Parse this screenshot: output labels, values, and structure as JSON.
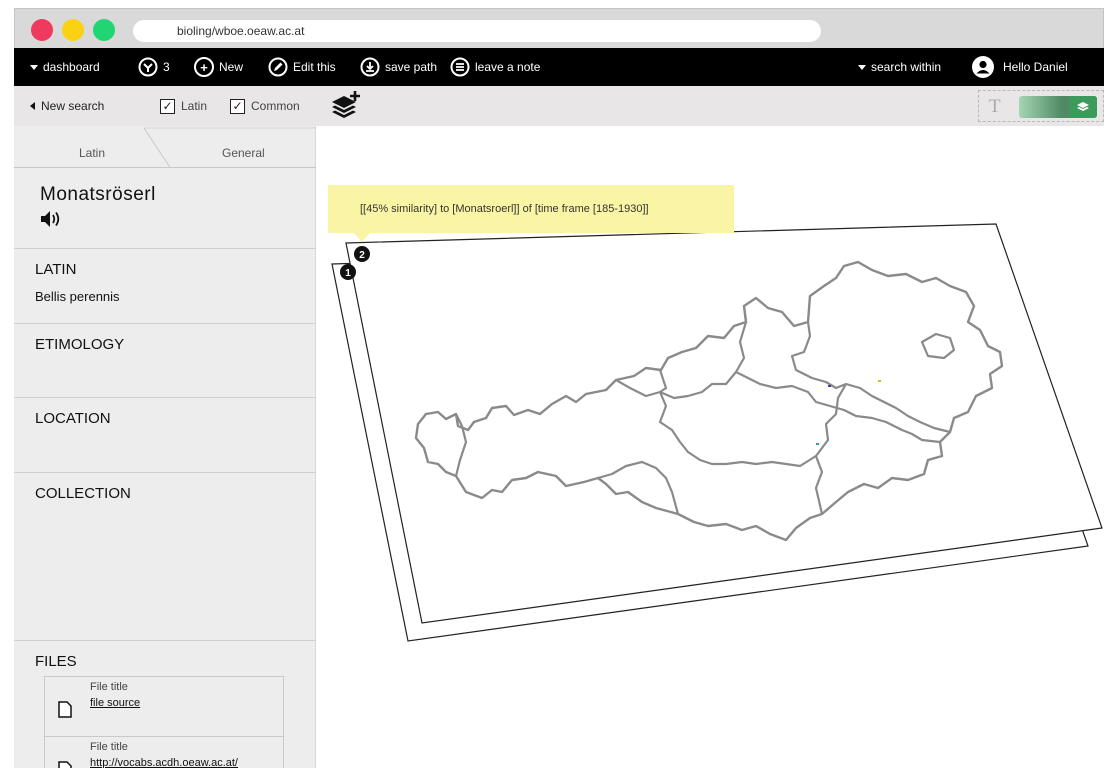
{
  "browser": {
    "url": "bioling/wboe.oeaw.ac.at",
    "buttons": {
      "close": "#ef3a5d",
      "minimize": "#fbd113",
      "maximize": "#21d572"
    }
  },
  "toolbar": {
    "dashboard": "dashboard",
    "filter_count": "3",
    "new": "New",
    "edit": "Edit this",
    "save_path": "save path",
    "note": "leave a note",
    "search_within": "search within",
    "user": "Hello Daniel"
  },
  "subbar": {
    "new_search": "New search",
    "latin": "Latin",
    "common": "Common",
    "latin_checked": true,
    "common_checked": true,
    "text_toggle": "T"
  },
  "sidebar": {
    "tabs": [
      "Latin",
      "General"
    ],
    "term": "Monatsröserl",
    "sections": {
      "latin_title": "LATIN",
      "latin_value": "Bellis perennis",
      "etimology": "ETIMOLOGY",
      "location": "LOCATION",
      "collection": "COLLECTION",
      "files": "FILES"
    },
    "files": [
      {
        "title": "File title",
        "source": "file source"
      },
      {
        "title": "File title",
        "source": "http://vocabs.acdh.oeaw.ac.at/"
      }
    ]
  },
  "main": {
    "tooltip": "[[45% similarity] to [Monatsroerl]] of [time frame [185-1930]]",
    "layer_front": "2",
    "layer_back": "1"
  },
  "colors": {
    "toolbar": "#000000",
    "accent_green": "#3c9a5a",
    "tooltip_bg": "#faf5a4",
    "map_line": "#888888"
  }
}
